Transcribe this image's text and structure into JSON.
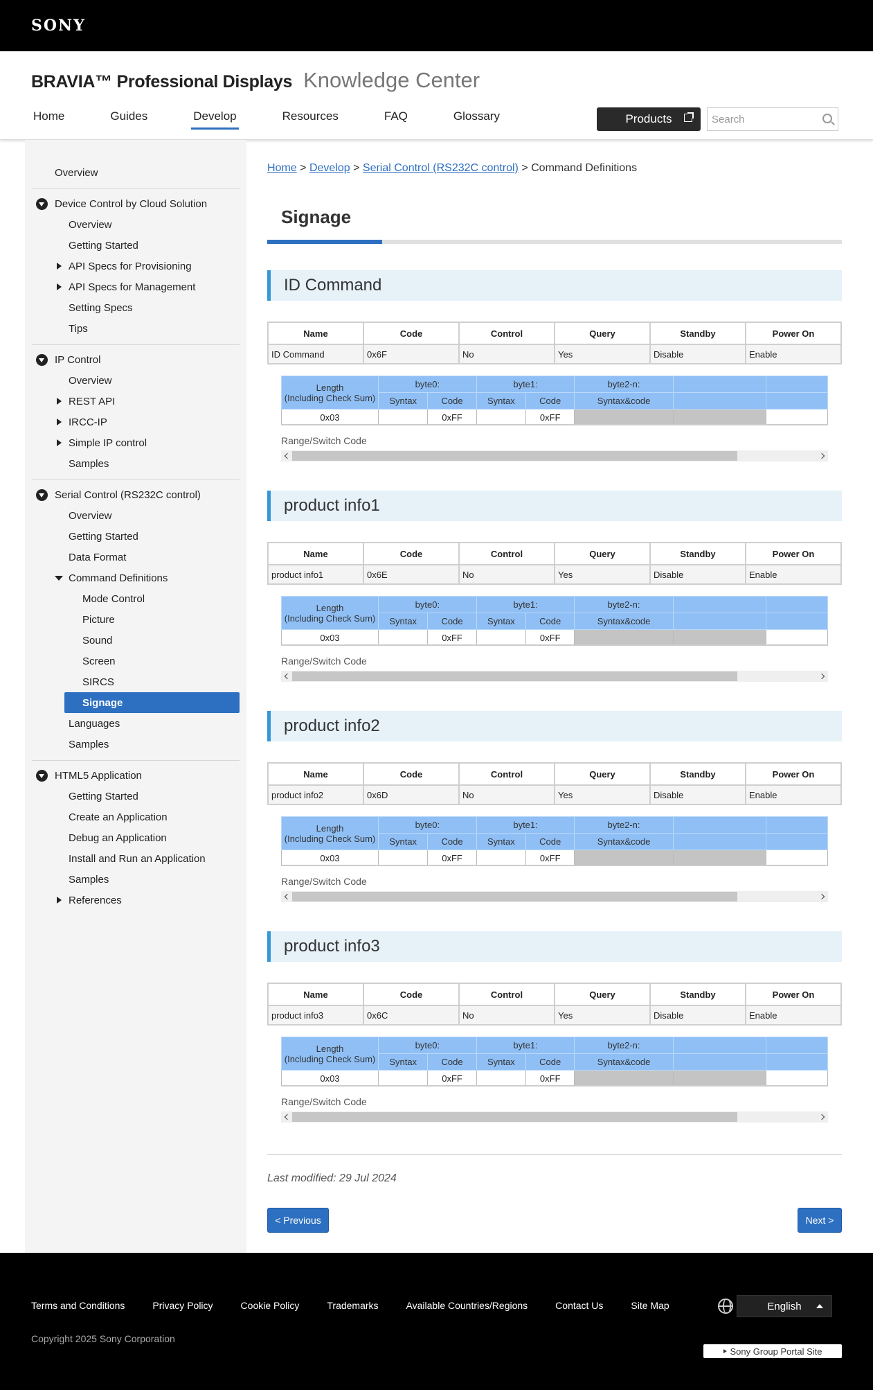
{
  "brand": {
    "logo": "SONY",
    "title": "BRAVIA™ Professional Displays",
    "subtitle": "Knowledge Center"
  },
  "nav": {
    "items": [
      "Home",
      "Guides",
      "Develop",
      "Resources",
      "FAQ",
      "Glossary"
    ],
    "active": "Develop",
    "products_label": "Products",
    "search_placeholder": "Search"
  },
  "sidebar": {
    "overview": "Overview",
    "cloud": {
      "label": "Device Control by Cloud Solution",
      "items": [
        "Overview",
        "Getting Started",
        "API Specs for Provisioning",
        "API Specs for Management",
        "Setting Specs",
        "Tips"
      ]
    },
    "ip": {
      "label": "IP Control",
      "items": [
        "Overview",
        "REST API",
        "IRCC-IP",
        "Simple IP control",
        "Samples"
      ]
    },
    "serial": {
      "label": "Serial Control (RS232C control)",
      "items": [
        "Overview",
        "Getting Started",
        "Data Format",
        "Command Definitions",
        "Languages",
        "Samples"
      ],
      "command_items": [
        "Mode Control",
        "Picture",
        "Sound",
        "Screen",
        "SIRCS",
        "Signage"
      ]
    },
    "html5": {
      "label": "HTML5 Application",
      "items": [
        "Getting Started",
        "Create an Application",
        "Debug an Application",
        "Install and Run an Application",
        "Samples",
        "References"
      ]
    }
  },
  "breadcrumb": {
    "home": "Home",
    "develop": "Develop",
    "serial": "Serial Control (RS232C control)",
    "current": "Command Definitions",
    "sep": ">"
  },
  "page": {
    "title": "Signage"
  },
  "table_headers": [
    "Name",
    "Code",
    "Control",
    "Query",
    "Standby",
    "Power On"
  ],
  "byte_headers": {
    "length": "Length",
    "length_sub": "(Including Check Sum)",
    "byte0": "byte0:",
    "byte1": "byte1:",
    "byte2": "byte2-n:",
    "syntax": "Syntax",
    "code": "Code",
    "syntax_code": "Syntax&code"
  },
  "range_label": "Range/Switch Code",
  "sections": [
    {
      "title": "ID Command",
      "row": [
        "ID Command",
        "0x6F",
        "No",
        "Yes",
        "Disable",
        "Enable"
      ],
      "length": "0x03",
      "byte0_code": "0xFF",
      "byte1_code": "0xFF"
    },
    {
      "title": "product info1",
      "row": [
        "product info1",
        "0x6E",
        "No",
        "Yes",
        "Disable",
        "Enable"
      ],
      "length": "0x03",
      "byte0_code": "0xFF",
      "byte1_code": "0xFF"
    },
    {
      "title": "product info2",
      "row": [
        "product info2",
        "0x6D",
        "No",
        "Yes",
        "Disable",
        "Enable"
      ],
      "length": "0x03",
      "byte0_code": "0xFF",
      "byte1_code": "0xFF"
    },
    {
      "title": "product info3",
      "row": [
        "product info3",
        "0x6C",
        "No",
        "Yes",
        "Disable",
        "Enable"
      ],
      "length": "0x03",
      "byte0_code": "0xFF",
      "byte1_code": "0xFF"
    }
  ],
  "last_modified": "Last modified: 29 Jul 2024",
  "pager": {
    "prev": "< Previous",
    "next": "Next >"
  },
  "footer": {
    "links": [
      "Terms and Conditions",
      "Privacy Policy",
      "Cookie Policy",
      "Trademarks",
      "Available Countries/Regions",
      "Contact Us",
      "Site Map"
    ],
    "language": "English",
    "copyright": "Copyright 2025 Sony Corporation",
    "portal": "Sony Group Portal Site"
  },
  "colors": {
    "accent": "#2d6fc0",
    "section_bar": "#3596d8",
    "byte_header": "#8fbff5"
  }
}
